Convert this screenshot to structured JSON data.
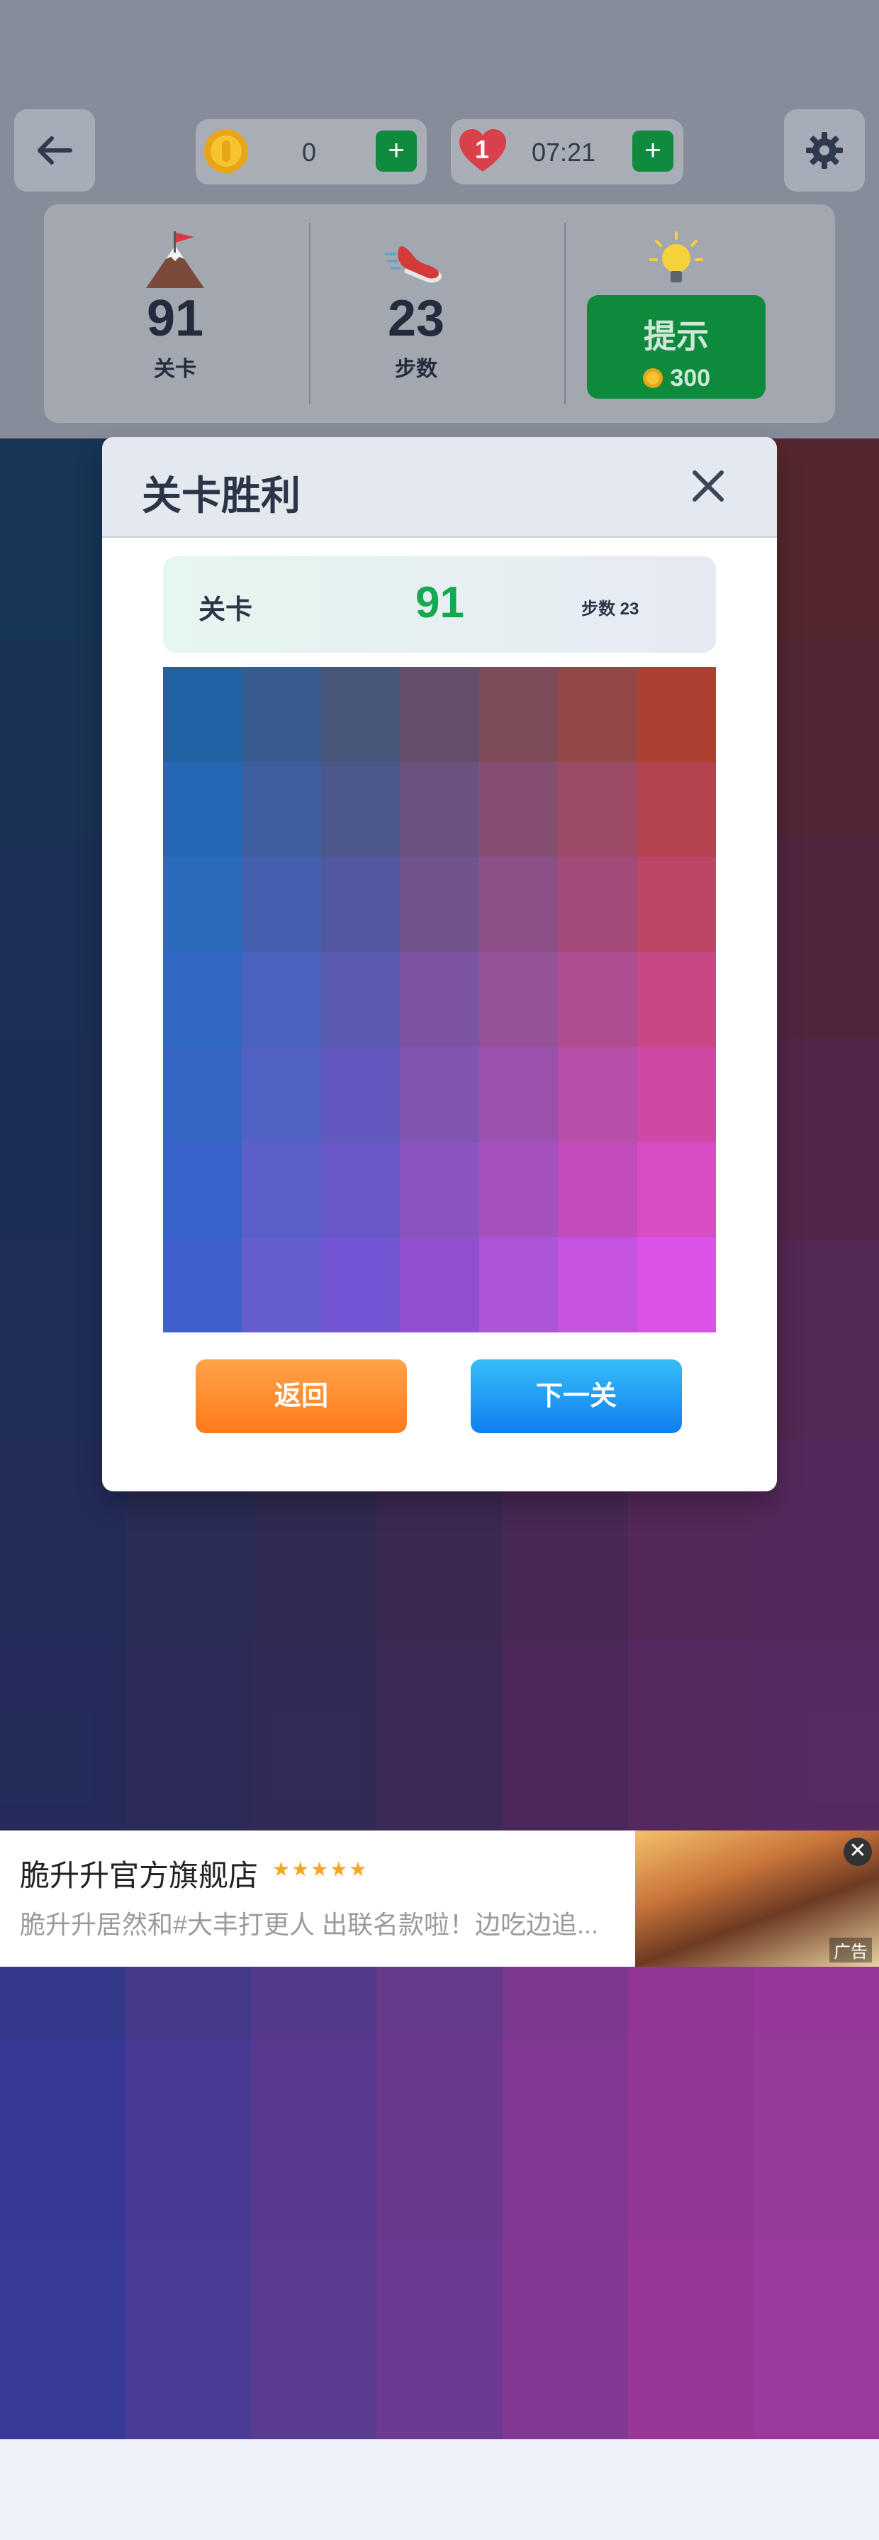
{
  "header": {
    "coins": "0",
    "lives": "1",
    "timer": "07:21",
    "plus_label": "+"
  },
  "stats": {
    "level_value": "91",
    "level_label": "关卡",
    "steps_value": "23",
    "steps_label": "步数",
    "hint_label": "提示",
    "hint_cost": "300"
  },
  "dialog": {
    "title": "关卡胜利",
    "level_label": "关卡",
    "level_value": "91",
    "steps_text": "步数 23",
    "back_label": "返回",
    "next_label": "下一关"
  },
  "board_colors": [
    [
      "#1f63a5",
      "#375c8e",
      "#475679",
      "#644f6d",
      "#7d4c58",
      "#944748",
      "#ae4032"
    ],
    [
      "#2467b3",
      "#3d5f9f",
      "#4c588b",
      "#6a5380",
      "#864f72",
      "#9c4a66",
      "#b4434f"
    ],
    [
      "#2a6bbd",
      "#435fae",
      "#5157a0",
      "#72548d",
      "#8c5086",
      "#a54b7a",
      "#bd4566"
    ],
    [
      "#3068c3",
      "#4b62bf",
      "#5a5bb1",
      "#7b55a2",
      "#955299",
      "#ae4d90",
      "#c84886"
    ],
    [
      "#3566c6",
      "#5262c4",
      "#6258bd",
      "#8355b3",
      "#9c52ad",
      "#b74ea7",
      "#d048a5"
    ],
    [
      "#3a63c9",
      "#5a5fca",
      "#6b58c8",
      "#8b54c1",
      "#a551be",
      "#c14dbd",
      "#d84cc4"
    ],
    [
      "#3f60cc",
      "#645ecf",
      "#7356d3",
      "#9250d0",
      "#ac55d6",
      "#c553df",
      "#dc51e6"
    ]
  ],
  "background_colors": [
    [
      "#1a4b75",
      "#2d3f60",
      "#343a5a",
      "#3f3556",
      "#5b3450",
      "#7a2e3d",
      "#8e3128"
    ],
    [
      "#1f4674",
      "#2c3c60",
      "#343a5c",
      "#423659",
      "#5d3350",
      "#7b2f42",
      "#8b2f3c"
    ],
    [
      "#224276",
      "#2e3b63",
      "#38385f",
      "#4a355c",
      "#633357",
      "#7e2f4a",
      "#8a2d4b"
    ],
    [
      "#263f78",
      "#333a66",
      "#3d3662",
      "#513461",
      "#6a335f",
      "#822f5b",
      "#8c2f5e"
    ],
    [
      "#2a3c7a",
      "#373a6b",
      "#433767",
      "#583566",
      "#703366",
      "#8a3169",
      "#8d326f"
    ],
    [
      "#2e3a7d",
      "#3c3a74",
      "#48366f",
      "#5e3570",
      "#773373",
      "#8e3279",
      "#8e3383"
    ],
    [
      "#32397f",
      "#41387b",
      "#4c367a",
      "#633679",
      "#7b357f",
      "#913488",
      "#93358f"
    ],
    [
      "#34388a",
      "#453a8a",
      "#533a8a",
      "#663a8a",
      "#7c398e",
      "#923694",
      "#963799"
    ],
    [
      "#363894",
      "#483992",
      "#573a90",
      "#6a398f",
      "#803893",
      "#933797",
      "#983a9a"
    ],
    [
      "#383a98",
      "#4a3b94",
      "#5a3b92",
      "#6c3a92",
      "#833994",
      "#973899",
      "#9a3a9c"
    ]
  ],
  "ad": {
    "title": "脆升升官方旗舰店",
    "stars": "★★★★★",
    "description": "脆升升居然和#大丰打更人 出联名款啦！边吃边追...",
    "close_label": "✕",
    "tag": "广告"
  },
  "colors": {
    "green": "#0e8a3c",
    "orange": "#ff8a2a",
    "blue": "#1b95f5"
  }
}
